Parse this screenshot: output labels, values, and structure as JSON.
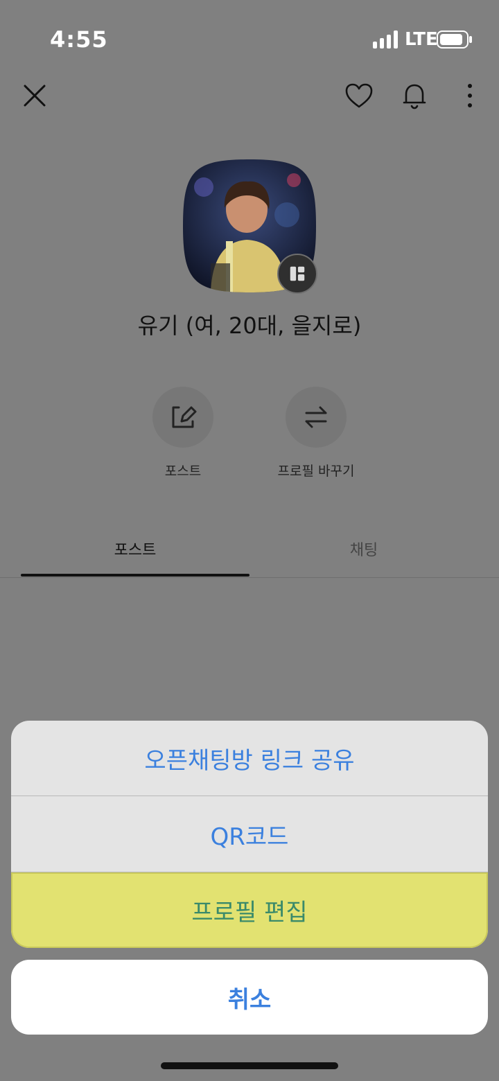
{
  "status": {
    "time": "4:55",
    "network": "LTE"
  },
  "topbar": {
    "icons": [
      "close-icon",
      "heart-icon",
      "bell-icon",
      "more-vertical-icon"
    ]
  },
  "profile": {
    "name": "유기 (여, 20대, 을지로)"
  },
  "actions": [
    {
      "label": "포스트",
      "icon": "edit-icon"
    },
    {
      "label": "프로필 바꾸기",
      "icon": "swap-icon"
    }
  ],
  "tabs": [
    {
      "label": "포스트",
      "active": true
    },
    {
      "label": "채팅",
      "active": false
    }
  ],
  "sheet": {
    "items": [
      {
        "label": "오픈채팅방 링크 공유"
      },
      {
        "label": "QR코드"
      },
      {
        "label": "프로필 편집",
        "highlighted": true
      }
    ],
    "cancel_label": "취소"
  },
  "colors": {
    "accent": "#3b80de",
    "highlight": "#e2e271",
    "overlay": "#808080"
  }
}
